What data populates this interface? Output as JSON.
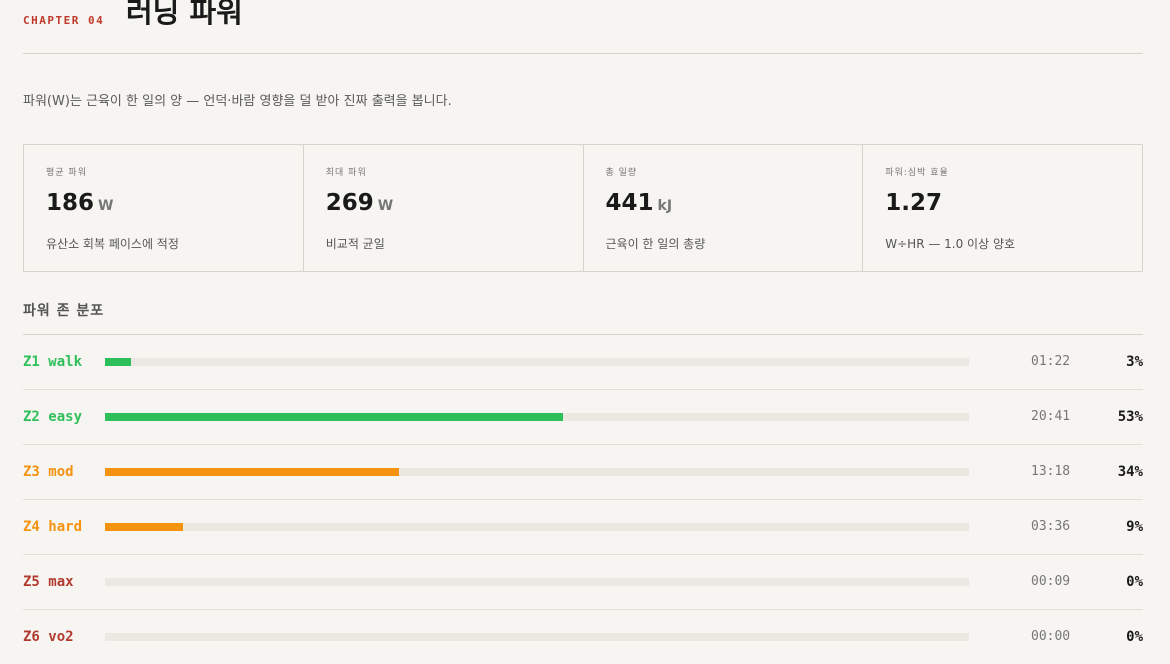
{
  "header": {
    "chapter": "CHAPTER 04",
    "title": "러닝 파워"
  },
  "intro": "파워(W)는 근육이 한 일의 양 — 언덕·바람 영향을 덜 받아 진짜 출력을 봅니다.",
  "stats": [
    {
      "label": "평균 파워",
      "value": "186",
      "unit": "W",
      "desc": "유산소 회복 페이스에 적정"
    },
    {
      "label": "최대 파워",
      "value": "269",
      "unit": "W",
      "desc": "비교적 균일"
    },
    {
      "label": "총 일량",
      "value": "441",
      "unit": "kJ",
      "desc": "근육이 한 일의 총량"
    },
    {
      "label": "파워:심박 효율",
      "value": "1.27",
      "unit": "",
      "desc": "W÷HR — 1.0 이상 양호"
    }
  ],
  "zones": {
    "title": "파워 존 분포",
    "items": [
      {
        "name": "Z1 walk",
        "time": "01:22",
        "pct": "3%",
        "fraction": 0.03,
        "color": "#2fbf5a"
      },
      {
        "name": "Z2 easy",
        "time": "20:41",
        "pct": "53%",
        "fraction": 0.53,
        "color": "#2fbf5a"
      },
      {
        "name": "Z3 mod",
        "time": "13:18",
        "pct": "34%",
        "fraction": 0.34,
        "color": "#f5920f"
      },
      {
        "name": "Z4 hard",
        "time": "03:36",
        "pct": "9%",
        "fraction": 0.09,
        "color": "#f5920f"
      },
      {
        "name": "Z5 max",
        "time": "00:09",
        "pct": "0%",
        "fraction": 0.0,
        "color": "#b23a2e"
      },
      {
        "name": "Z6 vo2",
        "time": "00:00",
        "pct": "0%",
        "fraction": 0.0,
        "color": "#b23a2e"
      }
    ]
  }
}
